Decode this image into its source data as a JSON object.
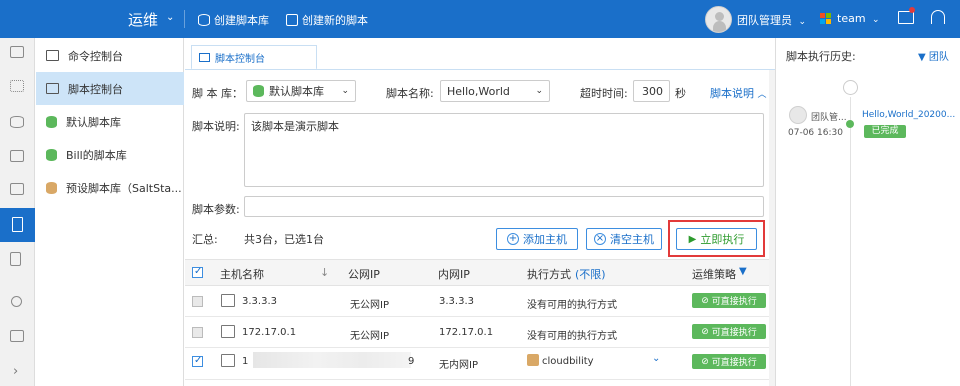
{
  "topbar": {
    "title": "运维",
    "actions": [
      {
        "label": "创建脚本库",
        "icon": "database-icon"
      },
      {
        "label": "创建新的脚本",
        "icon": "script-icon"
      }
    ],
    "user": "团队管理员",
    "team": "team"
  },
  "nav": {
    "items": [
      {
        "label": "命令控制台",
        "icon": "terminal-icon"
      },
      {
        "label": "脚本控制台",
        "icon": "script-console-icon",
        "active": true
      },
      {
        "label": "默认脚本库",
        "icon": "database-icon",
        "color": "#5cb85c"
      },
      {
        "label": "Bill的脚本库",
        "icon": "database-icon",
        "color": "#5cb85c"
      },
      {
        "label": "预设脚本库（SaltSta...",
        "icon": "database-icon",
        "color": "#d9a866"
      }
    ]
  },
  "tab": {
    "label": "脚本控制台"
  },
  "form": {
    "lib_label": "脚 本 库：",
    "lib_value": "默认脚本库",
    "name_label": "脚本名称:",
    "name_value": "Hello,World",
    "timeout_label": "超时时间:",
    "timeout_value": "300",
    "timeout_unit": "秒",
    "desc_link": "脚本说明",
    "desc_label": "脚本说明:",
    "desc_value": "该脚本是演示脚本",
    "param_label": "脚本参数:",
    "param_value": "",
    "summary_label": "汇总:",
    "summary_value": "共3台，已选1台",
    "add_host": "添加主机",
    "clear_host": "清空主机",
    "run_now": "立即执行"
  },
  "table": {
    "columns": [
      "主机名称",
      "公网IP",
      "内网IP",
      "执行方式",
      "(不限)",
      "运维策略"
    ],
    "rows": [
      {
        "host": "3.3.3.3",
        "public_ip": "无公网IP",
        "private_ip": "3.3.3.3",
        "exec": "没有可用的执行方式",
        "policy": "可直接执行",
        "checked": false
      },
      {
        "host": "172.17.0.1",
        "public_ip": "无公网IP",
        "private_ip": "172.17.0.1",
        "exec": "没有可用的执行方式",
        "policy": "可直接执行",
        "checked": false
      },
      {
        "host_prefix": "1",
        "host_suffix": "9",
        "public_ip": "",
        "private_ip": "无内网IP",
        "exec": "cloudbility",
        "policy": "可直接执行",
        "checked": true
      }
    ]
  },
  "history": {
    "title": "脚本执行历史:",
    "filter": "团队",
    "entries": [
      {
        "user": "团队管...",
        "time": "07-06 16:30",
        "script": "Hello,World_20200...",
        "status": "已完成"
      }
    ]
  },
  "colors": {
    "brand": "#1a6fc9",
    "success": "#5cb85c",
    "highlight": "#e23a3a"
  }
}
